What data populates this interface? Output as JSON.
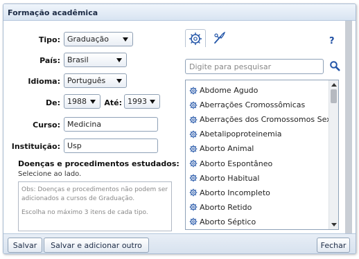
{
  "window": {
    "title": "Formação acadêmica"
  },
  "form": {
    "tipo": {
      "label": "Tipo:",
      "value": "Graduação"
    },
    "pais": {
      "label": "País:",
      "value": "Brasil"
    },
    "idioma": {
      "label": "Idioma:",
      "value": "Português"
    },
    "de": {
      "label": "De:",
      "value": "1988"
    },
    "ate": {
      "label": "Até:",
      "value": "1993"
    },
    "curso": {
      "label": "Curso:",
      "value": "Medicina"
    },
    "instituicao": {
      "label": "Instituição:",
      "value": "Usp"
    }
  },
  "diseases": {
    "title": "Doenças e procedimentos estudados:",
    "subtitle": "Selecione ao lado.",
    "obs_line1": "Obs: Doenças e procedimentos não podem ser",
    "obs_line2": "adicionados a cursos de Graduação.",
    "obs_line3": "Escolha no máximo 3 itens de cada tipo."
  },
  "panel": {
    "help": "?",
    "search_placeholder": "Digite para pesquisar",
    "tabs": [
      {
        "icon": "virus-icon"
      },
      {
        "icon": "scalpel-icon"
      }
    ],
    "items": [
      "Abdome Agudo",
      "Aberrações Cromossômicas",
      "Aberrações dos Cromossomos Sexuais",
      "Abetalipoproteinemia",
      "Aborto Animal",
      "Aborto Espontâneo",
      "Aborto Habitual",
      "Aborto Incompleto",
      "Aborto Retido",
      "Aborto Séptico"
    ]
  },
  "footer": {
    "save": "Salvar",
    "save_add": "Salvar e adicionar outro",
    "close": "Fechar"
  }
}
